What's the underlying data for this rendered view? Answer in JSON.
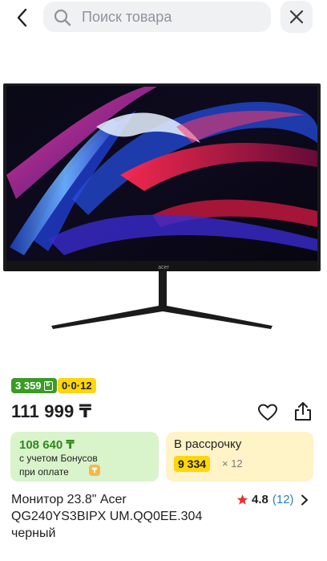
{
  "search": {
    "placeholder": "Поиск товара"
  },
  "icons": {
    "back": "chevron-left-icon",
    "search": "search-icon",
    "close": "close-icon",
    "favorite": "heart-icon",
    "share": "share-icon",
    "rating": "star-icon",
    "rating_more": "chevron-right-icon",
    "bonus": "bonus-icon",
    "tenge": "tenge-icon"
  },
  "colors": {
    "bonus_badge": "#3a9b25",
    "installment_badge": "#ffd60a",
    "bonus_card": "#d9f3cb",
    "installment_card": "#fff3c8",
    "star": "#e5332a",
    "rating_count": "#2a7fc0"
  },
  "badges": {
    "bonus": "3 359",
    "installment": "0·0·12"
  },
  "product": {
    "price": "111 999 ₸",
    "title_lines": [
      "Монитор 23.8\" Acer",
      "QG240YS3BIPX UM.QQ0EE.304",
      "черный"
    ],
    "rating": "4.8",
    "reviews": "(12)"
  },
  "bonus_card": {
    "amount": "108 640 ₸",
    "line1": "с учетом Бонусов",
    "line2": "при оплате"
  },
  "installment_card": {
    "title": "В рассрочку",
    "monthly": "9 334",
    "months": "× 12"
  },
  "monitor_brand": "acer"
}
